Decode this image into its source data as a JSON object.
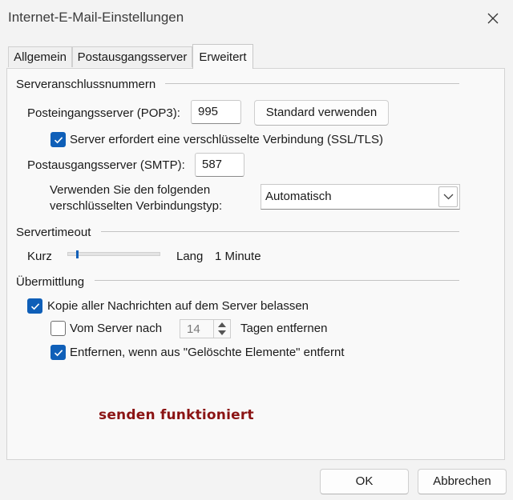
{
  "window": {
    "title": "Internet-E-Mail-Einstellungen",
    "close_icon": "close-icon"
  },
  "tabs": [
    {
      "label": "Allgemein",
      "active": false
    },
    {
      "label": "Postausgangsserver",
      "active": false
    },
    {
      "label": "Erweitert",
      "active": true
    }
  ],
  "server_ports": {
    "group_label": "Serveranschlussnummern",
    "incoming_label": "Posteingangsserver (POP3):",
    "incoming_value": "995",
    "default_button": "Standard verwenden",
    "ssl_checkbox": {
      "label": "Server erfordert eine verschlüsselte Verbindung (SSL/TLS)",
      "checked": true
    },
    "outgoing_label": "Postausgangsserver (SMTP):",
    "outgoing_value": "587",
    "encryption_label_line1": "Verwenden Sie den folgenden",
    "encryption_label_line2": "verschlüsselten Verbindungstyp:",
    "encryption_value": "Automatisch"
  },
  "server_timeout": {
    "group_label": "Servertimeout",
    "short_label": "Kurz",
    "long_label": "Lang",
    "value_text": "1 Minute",
    "slider_fraction": 0.03
  },
  "delivery": {
    "group_label": "Übermittlung",
    "keep_copy": {
      "label": "Kopie aller Nachrichten auf dem Server belassen",
      "checked": true
    },
    "remove_after": {
      "label": "Vom Server nach",
      "checked": false,
      "days_value": "14",
      "suffix": "Tagen entfernen"
    },
    "remove_deleted": {
      "label": "Entfernen, wenn aus \"Gelöschte Elemente\" entfernt",
      "checked": true
    }
  },
  "annotation_text": "senden funktioniert",
  "footer": {
    "ok_label": "OK",
    "cancel_label": "Abbrechen"
  },
  "colors": {
    "accent": "#0f5fb8",
    "annotation": "#8b1414"
  }
}
